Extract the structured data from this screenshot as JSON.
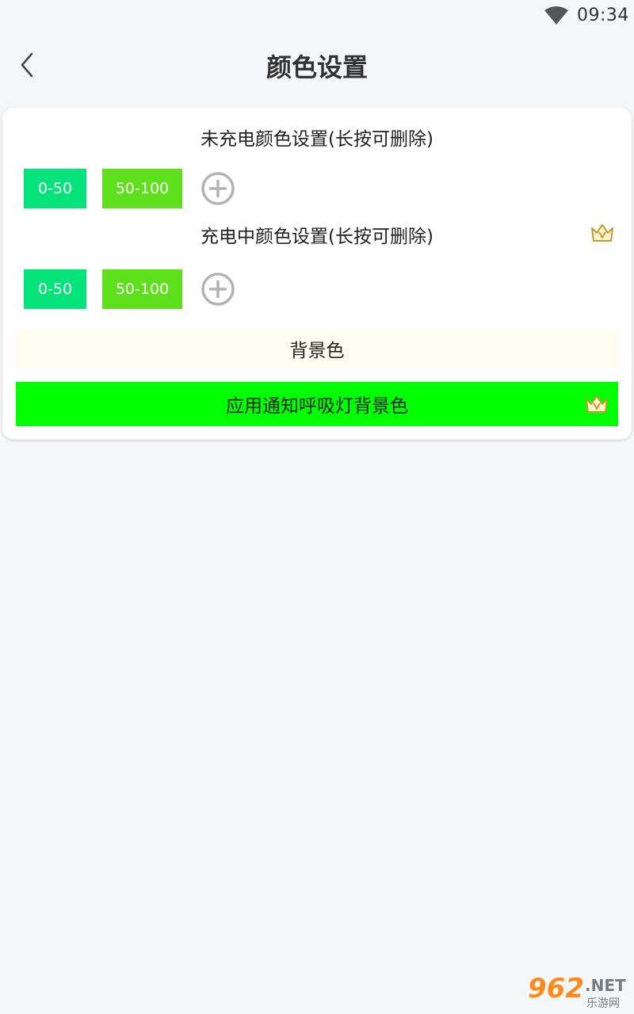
{
  "status_bar": {
    "time": "09:34",
    "wifi_icon": "wifi-icon"
  },
  "header": {
    "title": "颜色设置",
    "back_icon": "chevron-left-icon"
  },
  "uncharged": {
    "title": "未充电颜色设置(长按可删除)",
    "ranges": [
      {
        "label": "0-50",
        "color": "#05e37a"
      },
      {
        "label": "50-100",
        "color": "#5ee01c"
      }
    ],
    "add_icon": "plus-circle-icon"
  },
  "charging": {
    "title": "充电中颜色设置(长按可删除)",
    "vip_icon": "crown-icon",
    "ranges": [
      {
        "label": "0-50",
        "color": "#05e37a"
      },
      {
        "label": "50-100",
        "color": "#5ee01c"
      }
    ],
    "add_icon": "plus-circle-icon"
  },
  "background": {
    "label": "背景色",
    "color": "#fffdf0"
  },
  "notification": {
    "label": "应用通知呼吸灯背景色",
    "color": "#00ff00",
    "vip_icon": "crown-icon"
  },
  "watermark": {
    "number": "962",
    "suffix": ".NET",
    "subtitle": "乐游网"
  }
}
